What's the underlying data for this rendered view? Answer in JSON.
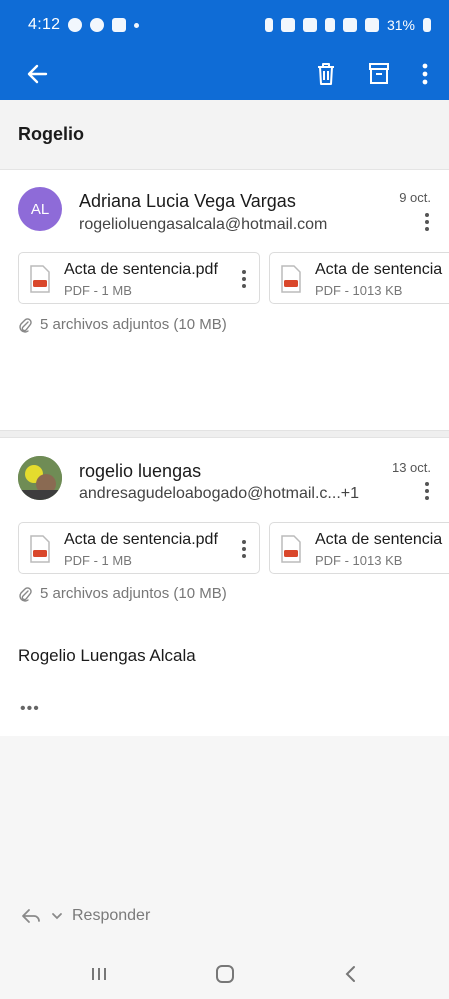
{
  "status": {
    "time": "4:12",
    "battery": "31%"
  },
  "appbar": {
    "icons": [
      "back-arrow-icon",
      "trash-icon",
      "archive-icon",
      "more-vert-icon"
    ]
  },
  "thread": {
    "subject": "Rogelio"
  },
  "messages": [
    {
      "avatar_initials": "AL",
      "avatar_color": "#8e6bd8",
      "sender": "Adriana Lucia Vega Vargas",
      "email": "rogelioluengasalcala@hotmail.com",
      "date": "9 oct.",
      "attachments": [
        {
          "name": "Acta de sentencia.pdf",
          "meta": "PDF - 1 MB"
        },
        {
          "name": "Acta de sentencia",
          "meta": "PDF - 1013 KB"
        }
      ],
      "attach_summary": "5 archivos adjuntos (10 MB)"
    },
    {
      "sender": "rogelio luengas",
      "email": "andresagudeloabogado@hotmail.c...+1",
      "date": "13 oct.",
      "attachments": [
        {
          "name": "Acta de sentencia.pdf",
          "meta": "PDF - 1 MB"
        },
        {
          "name": "Acta de sentencia",
          "meta": "PDF - 1013 KB"
        }
      ],
      "attach_summary": "5 archivos adjuntos (10 MB)",
      "body": "Rogelio Luengas Alcala",
      "more": "•••"
    }
  ],
  "footer": {
    "reply_label": "Responder"
  },
  "colors": {
    "accent": "#0f6cd6",
    "pdf_red": "#d9472b"
  }
}
